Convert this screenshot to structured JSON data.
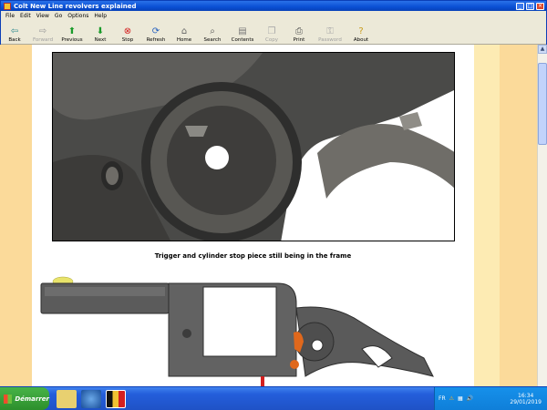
{
  "window": {
    "title": "Colt New Line revolvers explained"
  },
  "menu": [
    "File",
    "Edit",
    "View",
    "Go",
    "Options",
    "Help"
  ],
  "toolbar": {
    "back": "Back",
    "forward": "Forward",
    "previous": "Previous",
    "next": "Next",
    "stop": "Stop",
    "refresh": "Refresh",
    "home": "Home",
    "search": "Search",
    "contents": "Contents",
    "copy": "Copy",
    "print": "Print",
    "password": "Password",
    "about": "About"
  },
  "page": {
    "caption": "Trigger and cylinder stop piece still being in the frame"
  },
  "taskbar": {
    "start": "Démarrer",
    "lang": "FR",
    "time": "16:34",
    "date": "29/01/2019"
  },
  "colors": {
    "page_background": "#fbda9a",
    "accent_orange": "#e0681c",
    "title_blue": "#0a4fd4"
  }
}
